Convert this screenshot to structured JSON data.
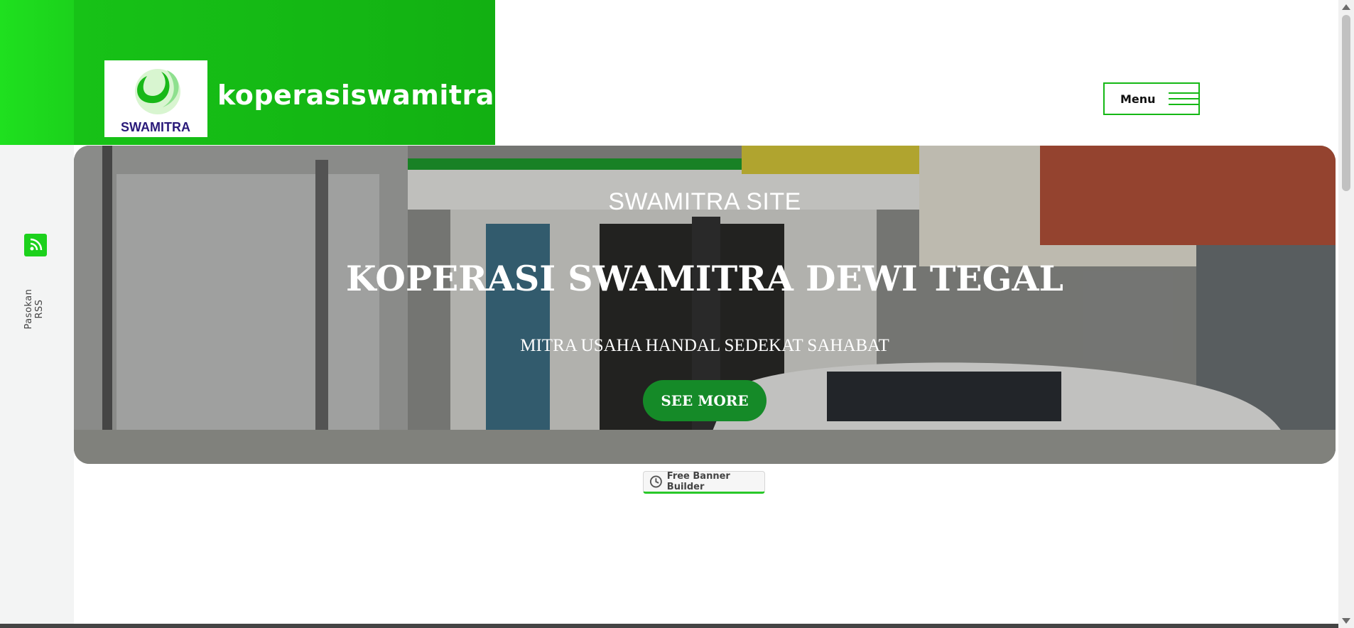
{
  "header": {
    "site_name": "koperasiswamitra",
    "logo_text": "SWAMITRA",
    "menu_label": "Menu"
  },
  "sidebar": {
    "rss_label": "Pasokan RSS"
  },
  "banner": {
    "kicker": "SWAMITRA SITE",
    "title": "KOPERASI SWAMITRA DEWI TEGAL",
    "subtitle": "MITRA USAHA HANDAL SEDEKAT SAHABAT",
    "cta_label": "SEE MORE"
  },
  "badge": {
    "label": "Free Banner Builder"
  },
  "colors": {
    "brand_green": "#17c217",
    "cta_green": "#158a28"
  }
}
